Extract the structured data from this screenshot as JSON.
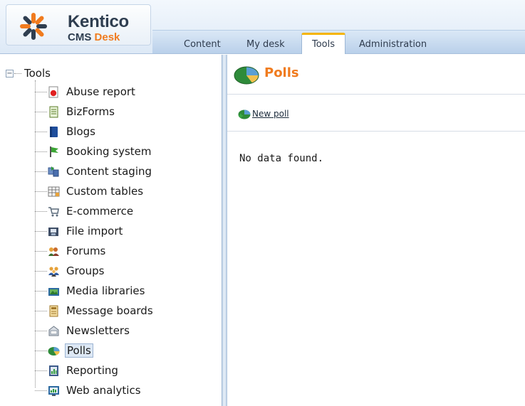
{
  "app": {
    "brand_name": "Kentico",
    "brand_product": "CMS",
    "brand_product_accent": "Desk",
    "brand_color": "#f07b1e"
  },
  "tabs": [
    {
      "label": "Content",
      "active": false
    },
    {
      "label": "My desk",
      "active": false
    },
    {
      "label": "Tools",
      "active": true
    },
    {
      "label": "Administration",
      "active": false
    }
  ],
  "tree": {
    "root_label": "Tools",
    "items": [
      {
        "label": "Abuse report",
        "icon": "abuse-report-icon"
      },
      {
        "label": "BizForms",
        "icon": "bizforms-icon"
      },
      {
        "label": "Blogs",
        "icon": "blogs-icon"
      },
      {
        "label": "Booking system",
        "icon": "booking-system-icon"
      },
      {
        "label": "Content staging",
        "icon": "content-staging-icon"
      },
      {
        "label": "Custom tables",
        "icon": "custom-tables-icon"
      },
      {
        "label": "E-commerce",
        "icon": "e-commerce-icon"
      },
      {
        "label": "File import",
        "icon": "file-import-icon"
      },
      {
        "label": "Forums",
        "icon": "forums-icon"
      },
      {
        "label": "Groups",
        "icon": "groups-icon"
      },
      {
        "label": "Media libraries",
        "icon": "media-libraries-icon"
      },
      {
        "label": "Message boards",
        "icon": "message-boards-icon"
      },
      {
        "label": "Newsletters",
        "icon": "newsletters-icon"
      },
      {
        "label": "Polls",
        "icon": "polls-icon",
        "selected": true
      },
      {
        "label": "Reporting",
        "icon": "reporting-icon"
      },
      {
        "label": "Web analytics",
        "icon": "web-analytics-icon"
      }
    ]
  },
  "main": {
    "title": "Polls",
    "new_poll_label": "New poll",
    "empty_message": "No data found."
  }
}
